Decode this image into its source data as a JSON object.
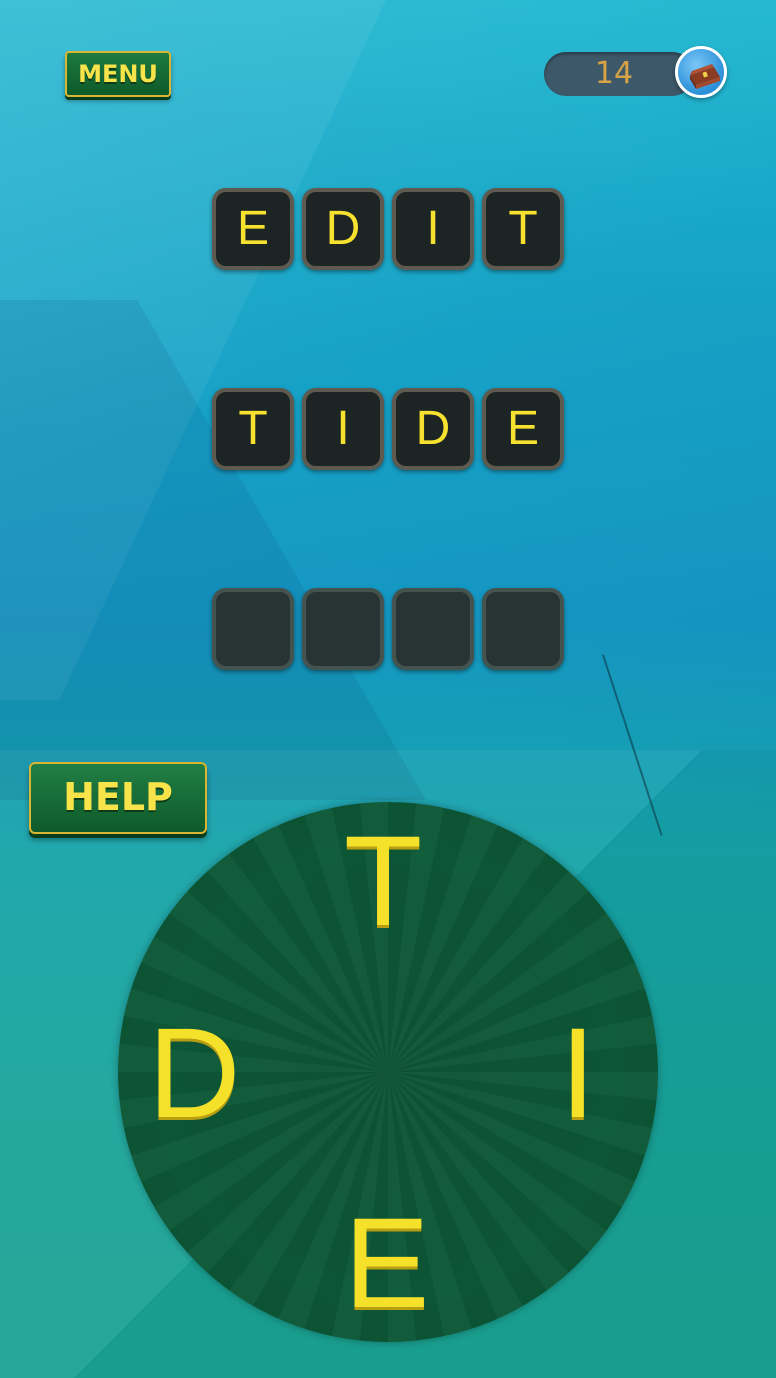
{
  "header": {
    "menu_label": "MENU",
    "coins": "14",
    "coin_icon": "treasure-chest-icon"
  },
  "board": {
    "rows": [
      {
        "letters": [
          "E",
          "D",
          "I",
          "T"
        ],
        "solved": true
      },
      {
        "letters": [
          "T",
          "I",
          "D",
          "E"
        ],
        "solved": true
      },
      {
        "letters": [
          "",
          "",
          "",
          ""
        ],
        "solved": false
      }
    ]
  },
  "help_label": "HELP",
  "wheel": {
    "letters": [
      "T",
      "I",
      "E",
      "D"
    ]
  },
  "colors": {
    "letter": "#f7e12f",
    "button_green": "#1a6e39",
    "button_border": "#d9b632",
    "wheel": "#0d5a38",
    "tile": "#1d2424"
  }
}
